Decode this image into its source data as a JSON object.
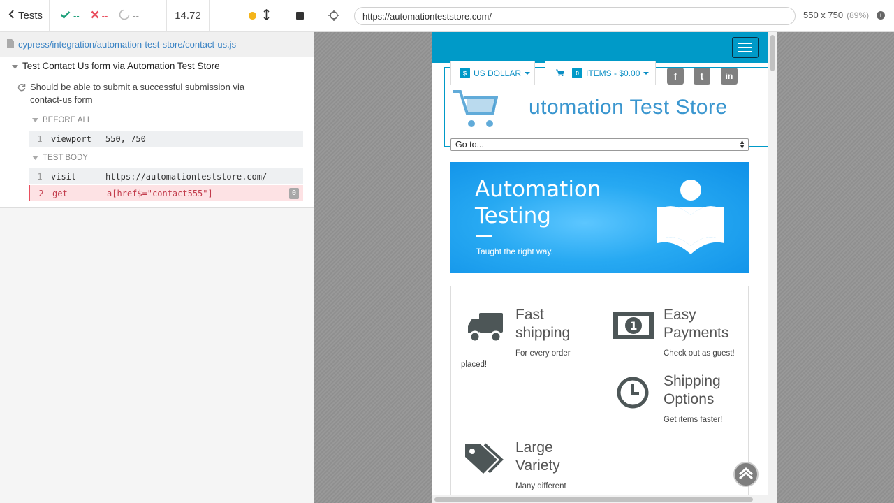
{
  "reporter": {
    "tests_label": "Tests",
    "passed": "--",
    "failed": "--",
    "pending": "--",
    "duration": "14.72",
    "spec_path": "cypress/integration/automation-test-store/contact-us.js",
    "suite_title": "Test Contact Us form via Automation Test Store",
    "test_title": "Should be able to submit a successful submission via contact-us form",
    "before_all_label": "BEFORE ALL",
    "test_body_label": "TEST BODY",
    "before_all_commands": [
      {
        "num": "1",
        "name": "viewport",
        "arg": "550, 750"
      }
    ],
    "test_body_commands": [
      {
        "num": "1",
        "name": "visit",
        "arg": "https://automationteststore.com/"
      },
      {
        "num": "2",
        "name": "get",
        "arg": "a[href$=\"contact555\"]",
        "badge": "0"
      }
    ]
  },
  "runner": {
    "url": "https://automationteststore.com/",
    "viewport_size": "550 x 750",
    "viewport_pct": "(89%)"
  },
  "aut": {
    "logo_text": "utomation Test Store",
    "currency_label": "US DOLLAR",
    "currency_badge": "$",
    "cart_badge": "0",
    "cart_label": "ITEMS - $0.00",
    "social": [
      "f",
      "t",
      "in"
    ],
    "goto_label": "Go to...",
    "banner_title_line1": "Automation",
    "banner_title_line2": "Testing",
    "banner_subtitle": "Taught the right way.",
    "features": [
      {
        "title_l1": "Fast",
        "title_l2": "shipping",
        "desc_l1": "For every order",
        "desc_l2": "placed!"
      },
      {
        "title_l1": "Easy",
        "title_l2": "Payments",
        "desc_l1": "Check out as guest!"
      },
      {
        "title_l1": "Shipping",
        "title_l2": "Options",
        "desc_l1": "Get items faster!"
      },
      {
        "title_l1": "Large",
        "title_l2": "Variety",
        "desc_l1": "Many different"
      }
    ]
  },
  "colors": {
    "accent": "#009ac8",
    "pass": "#1ea07a",
    "fail": "#e94f5f",
    "banner": "#27a9f2"
  }
}
